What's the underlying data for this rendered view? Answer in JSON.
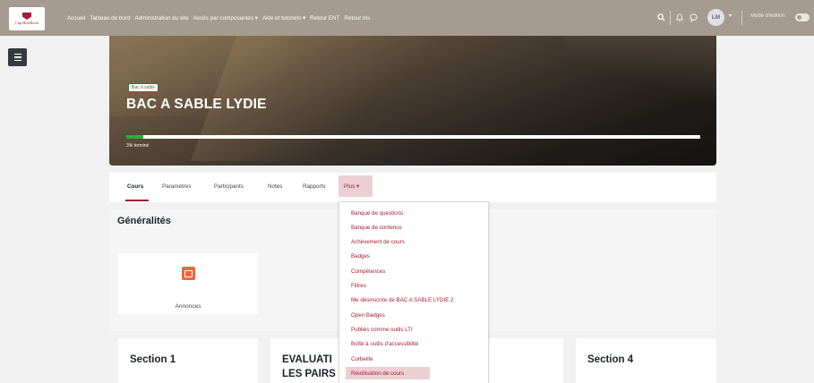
{
  "navbar": {
    "logo_text": "Cap Hôtellerie",
    "links": [
      {
        "label": "Accueil",
        "dropdown": false
      },
      {
        "label": "Tableau de bord",
        "dropdown": false
      },
      {
        "label": "Administration du site",
        "dropdown": false
      },
      {
        "label": "Accès par composantes",
        "dropdown": true
      },
      {
        "label": "Aide et tutoriels",
        "dropdown": true
      },
      {
        "label": "Retour ENT",
        "dropdown": false
      },
      {
        "label": "Retour Iris",
        "dropdown": false
      }
    ],
    "avatar_initials": "LM",
    "edit_mode_label": "Mode d'édition",
    "icons": [
      "search-icon",
      "bell-icon",
      "chat-icon"
    ]
  },
  "course": {
    "badge": "Bac à sable",
    "title": "BAC A SABLE LYDIE",
    "progress_percent": 3,
    "progress_label": "3% terminé"
  },
  "secondary_nav": {
    "items": [
      "Cours",
      "Paramètres",
      "Participants",
      "Notes",
      "Rapports"
    ],
    "active": "Cours",
    "more_label": "Plus"
  },
  "more_menu": {
    "items": [
      "Banque de questions",
      "Banque de contenus",
      "Achèvement de cours",
      "Badges",
      "Compétences",
      "Filtres",
      "Me désinscrire de BAC A SABLE LYDIE 2",
      "Open Badges",
      "Publiés comme outils LTI",
      "Boîte à outils d'accessibilité",
      "Corbeille",
      "Réutilisation de cours"
    ],
    "highlighted": "Réutilisation de cours"
  },
  "content": {
    "general_title": "Généralités",
    "activity_label": "Annonces",
    "sections": [
      {
        "title": "Section 1"
      },
      {
        "title": "EVALUATION ENTRE LES PAIRS",
        "visible_line1": "EVALUATI",
        "visible_line2": "LES PAIRS"
      },
      {
        "title": "Section 4"
      }
    ]
  },
  "colors": {
    "navbar": "#a59b90",
    "accent": "#a31f34",
    "highlight": "#eccfd4",
    "progress": "#2eaa3f",
    "announce_icon": "#f06440"
  }
}
